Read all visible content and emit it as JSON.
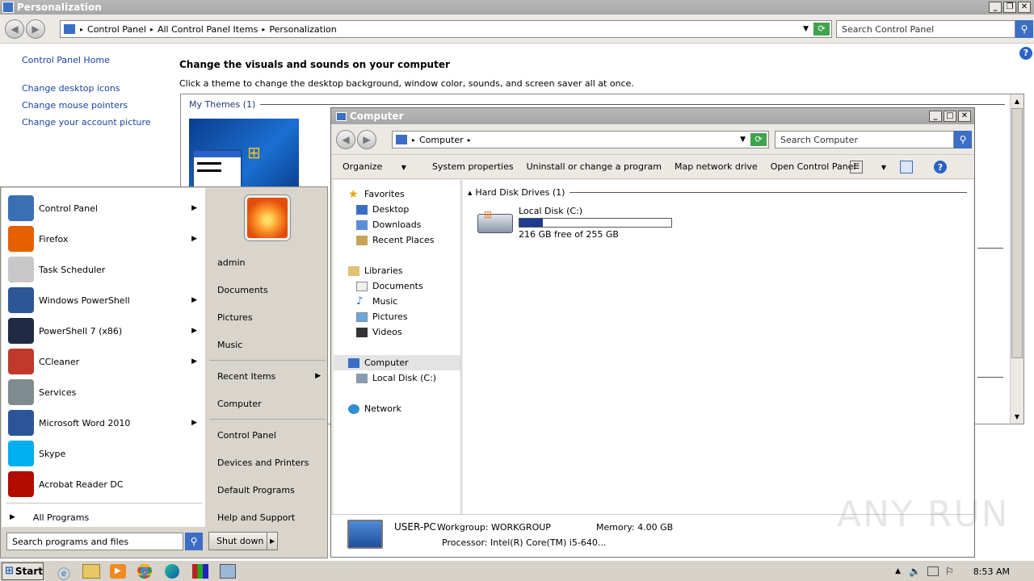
{
  "personalization": {
    "title": "Personalization",
    "breadcrumb": [
      "Control Panel",
      "All Control Panel Items",
      "Personalization"
    ],
    "search_placeholder": "Search Control Panel",
    "sidebar_home": "Control Panel Home",
    "sidebar_links": [
      "Change desktop icons",
      "Change mouse pointers",
      "Change your account picture"
    ],
    "heading": "Change the visuals and sounds on your computer",
    "subheading": "Click a theme to change the desktop background, window color, sounds, and screen saver all at once.",
    "my_themes": "My Themes (1)"
  },
  "computer": {
    "title": "Computer",
    "address": "Computer",
    "search_placeholder": "Search Computer",
    "toolbar": [
      "Organize",
      "System properties",
      "Uninstall or change a program",
      "Map network drive",
      "Open Control Panel"
    ],
    "nav": {
      "favorites": "Favorites",
      "fav_items": [
        "Desktop",
        "Downloads",
        "Recent Places"
      ],
      "libraries": "Libraries",
      "lib_items": [
        "Documents",
        "Music",
        "Pictures",
        "Videos"
      ],
      "computer": "Computer",
      "local_disk": "Local Disk (C:)",
      "network": "Network"
    },
    "group": "Hard Disk Drives (1)",
    "drive": {
      "name": "Local Disk (C:)",
      "free": "216 GB free of 255 GB",
      "used_fraction": 0.153
    },
    "details": {
      "pc": "USER-PC",
      "workgroup": "Workgroup: WORKGROUP",
      "memory": "Memory: 4.00 GB",
      "processor": "Processor: Intel(R) Core(TM) i5-640..."
    }
  },
  "start_menu": {
    "left_items": [
      {
        "label": "Control Panel",
        "arrow": true,
        "color": "#3a6fb5"
      },
      {
        "label": "Firefox",
        "arrow": true,
        "color": "#e66000"
      },
      {
        "label": "Task Scheduler",
        "arrow": false,
        "color": "#c8c8c8"
      },
      {
        "label": "Windows PowerShell",
        "arrow": true,
        "color": "#2b5797"
      },
      {
        "label": "PowerShell 7 (x86)",
        "arrow": true,
        "color": "#1f2a44"
      },
      {
        "label": "CCleaner",
        "arrow": true,
        "color": "#c0392b"
      },
      {
        "label": "Services",
        "arrow": false,
        "color": "#7f8c8d"
      },
      {
        "label": "Microsoft Word 2010",
        "arrow": true,
        "color": "#2a5699"
      },
      {
        "label": "Skype",
        "arrow": false,
        "color": "#00aff0"
      },
      {
        "label": "Acrobat Reader DC",
        "arrow": false,
        "color": "#b30b00"
      }
    ],
    "all_programs": "All Programs",
    "search_placeholder": "Search programs and files",
    "right_items": [
      "admin",
      "Documents",
      "Pictures",
      "Music"
    ],
    "recent_items": "Recent Items",
    "computer": "Computer",
    "right_items2": [
      "Control Panel",
      "Devices and Printers",
      "Default Programs",
      "Help and Support"
    ],
    "shutdown": "Shut down"
  },
  "taskbar": {
    "start": "Start",
    "clock": "8:53 AM"
  },
  "watermark": "ANY RUN"
}
